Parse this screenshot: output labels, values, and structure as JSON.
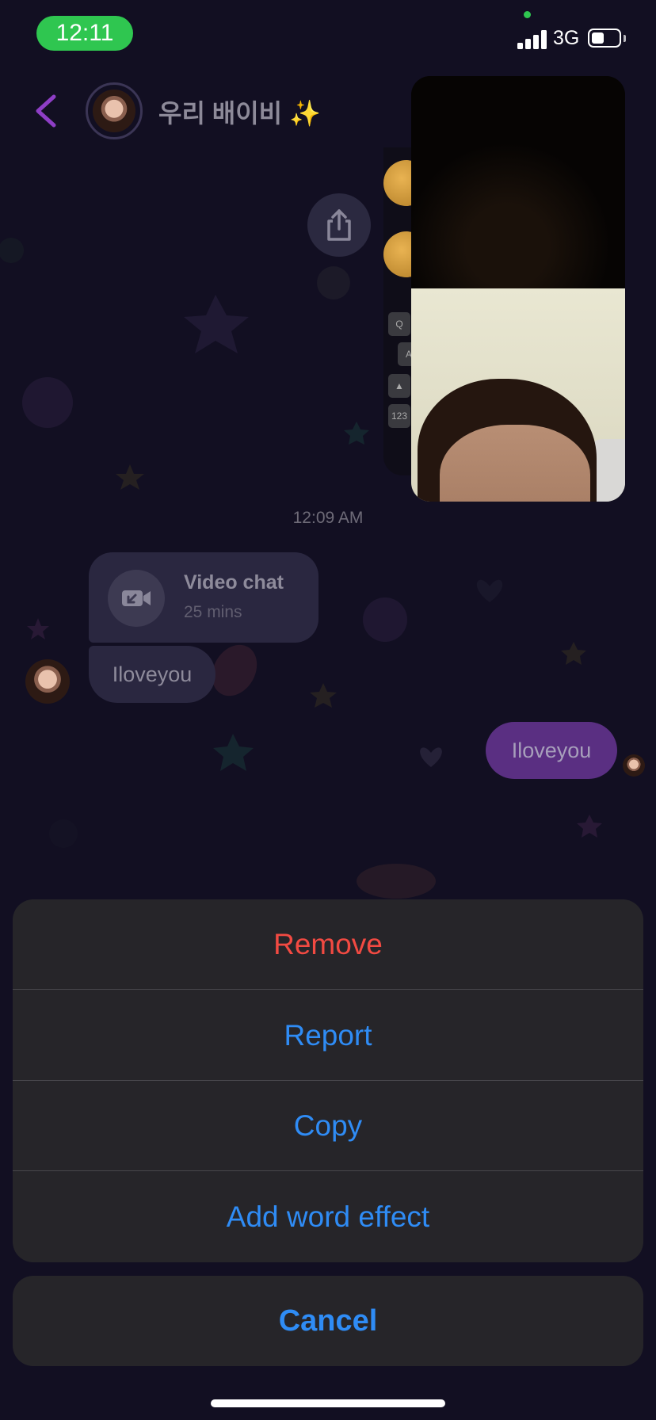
{
  "status_bar": {
    "time": "12:11",
    "network": "3G",
    "colors": {
      "time_pill": "#2fc650"
    }
  },
  "header": {
    "back_icon": "chevron-left-icon",
    "title": "우리 배이비 ✨",
    "accent_color": "#8e3ec6"
  },
  "video_pip": {
    "description_icon": "video-feed"
  },
  "chat": {
    "timestamp": "12:09 AM",
    "video_chat": {
      "icon": "video-camera-icon",
      "title": "Video chat",
      "duration": "25 mins"
    },
    "messages": [
      {
        "direction": "incoming",
        "text": "Iloveyou"
      },
      {
        "direction": "outgoing",
        "text": "Iloveyou"
      }
    ],
    "share_icon": "share-icon"
  },
  "action_sheet": {
    "items": [
      {
        "label": "Remove",
        "style": "destructive",
        "color": "#f24a42"
      },
      {
        "label": "Report",
        "style": "default",
        "color": "#2f8cf5"
      },
      {
        "label": "Copy",
        "style": "default",
        "color": "#2f8cf5"
      },
      {
        "label": "Add word effect",
        "style": "default",
        "color": "#2f8cf5"
      }
    ],
    "cancel_label": "Cancel"
  }
}
